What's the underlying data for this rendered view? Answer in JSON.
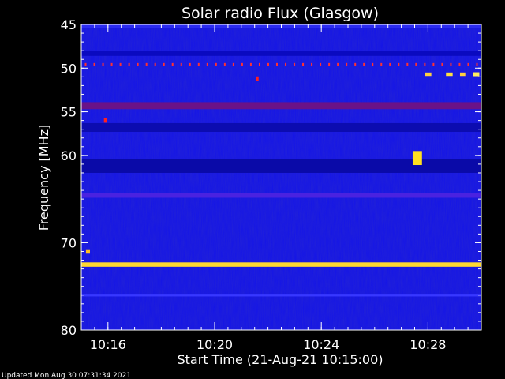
{
  "chart_data": {
    "type": "heatmap",
    "title": "Solar radio Flux (Glasgow)",
    "xlabel": "Start Time (21-Aug-21 10:15:00)",
    "ylabel": "Frequency [MHz]",
    "footer": "Updated Mon Aug 30 07:31:34 2021",
    "x_unit": "minutes since 10:15:00",
    "xlim": [
      0,
      15
    ],
    "ylim": [
      45,
      80
    ],
    "y_inverted": true,
    "x_ticks": [
      {
        "value": 1,
        "label": "10:16"
      },
      {
        "value": 5,
        "label": "10:20"
      },
      {
        "value": 9,
        "label": "10:24"
      },
      {
        "value": 13,
        "label": "10:28"
      }
    ],
    "y_ticks": [
      {
        "value": 45,
        "label": "45"
      },
      {
        "value": 50,
        "label": "50"
      },
      {
        "value": 55,
        "label": "55"
      },
      {
        "value": 60,
        "label": "60"
      },
      {
        "value": 70,
        "label": "70"
      },
      {
        "value": 80,
        "label": "80"
      }
    ],
    "background_color": "#1414e8",
    "horizontal_bands": [
      {
        "freq": 45.2,
        "thickness": 0.4,
        "color": "#2c2cf0"
      },
      {
        "freq": 48.3,
        "thickness": 0.6,
        "color": "#0a0ac0"
      },
      {
        "freq": 54.3,
        "thickness": 0.8,
        "color": "#6a1288"
      },
      {
        "freq": 56.8,
        "thickness": 1.0,
        "color": "#0c0cb0"
      },
      {
        "freq": 61.2,
        "thickness": 1.6,
        "color": "#0a0aa8"
      },
      {
        "freq": 64.6,
        "thickness": 0.5,
        "color": "#4a22e0"
      },
      {
        "freq": 72.5,
        "thickness": 0.5,
        "color": "#ffd830"
      },
      {
        "freq": 76.0,
        "thickness": 0.3,
        "color": "#3838ff"
      }
    ],
    "dotted_band": {
      "freq": 49.6,
      "color": "#ff3030",
      "count": 46
    },
    "bursts": [
      {
        "time": 12.6,
        "freq": 60.3,
        "width": 0.35,
        "height": 1.6,
        "color": "#ffe020"
      },
      {
        "time": 13.0,
        "freq": 50.7,
        "width": 0.25,
        "height": 0.4,
        "color": "#ffd040"
      },
      {
        "time": 13.8,
        "freq": 50.7,
        "width": 0.25,
        "height": 0.4,
        "color": "#ffe040"
      },
      {
        "time": 14.3,
        "freq": 50.7,
        "width": 0.2,
        "height": 0.4,
        "color": "#ffd040"
      },
      {
        "time": 14.8,
        "freq": 50.7,
        "width": 0.25,
        "height": 0.45,
        "color": "#ffee60"
      },
      {
        "time": 0.25,
        "freq": 71.0,
        "width": 0.15,
        "height": 0.5,
        "color": "#ffc020"
      },
      {
        "time": 0.9,
        "freq": 56.0,
        "width": 0.1,
        "height": 0.5,
        "color": "#ff2020"
      },
      {
        "time": 6.6,
        "freq": 51.2,
        "width": 0.1,
        "height": 0.5,
        "color": "#ff2020"
      }
    ]
  }
}
